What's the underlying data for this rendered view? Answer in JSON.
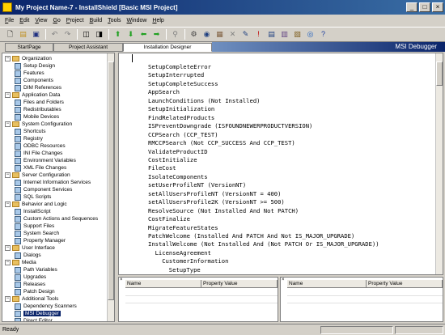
{
  "window": {
    "title": "My Project Name-7 - InstallShield [Basic MSI Project]"
  },
  "menu": [
    {
      "label": "File",
      "key": "F",
      "rest": "ile"
    },
    {
      "label": "Edit",
      "key": "E",
      "rest": "dit"
    },
    {
      "label": "View",
      "key": "V",
      "rest": "iew"
    },
    {
      "label": "Go",
      "key": "G",
      "rest": "o"
    },
    {
      "label": "Project",
      "key": "P",
      "rest": "roject"
    },
    {
      "label": "Build",
      "key": "B",
      "rest": "uild"
    },
    {
      "label": "Tools",
      "key": "T",
      "rest": "ools"
    },
    {
      "label": "Window",
      "key": "W",
      "rest": "indow"
    },
    {
      "label": "Help",
      "key": "H",
      "rest": "elp"
    }
  ],
  "tabs": {
    "start_page": "StartPage",
    "project_assistant": "Project Assistant",
    "installation_designer": "Installation Designer",
    "view_title": "MSI Debugger"
  },
  "tree": {
    "organization": "Organization",
    "setup_design": "Setup Design",
    "features": "Features",
    "components": "Components",
    "dim_references": "DIM References",
    "application_data": "Application Data",
    "files_and_folders": "Files and Folders",
    "redistributables": "Redistributables",
    "mobile_devices": "Mobile Devices",
    "system_configuration": "System Configuration",
    "shortcuts": "Shortcuts",
    "registry": "Registry",
    "odbc_resources": "ODBC Resources",
    "ini_file_changes": "INI File Changes",
    "environment_variables": "Environment Variables",
    "xml_file_changes": "XML File Changes",
    "server_configuration": "Server Configuration",
    "internet_information_services": "Internet Information Services",
    "component_services": "Component Services",
    "sql_scripts": "SQL Scripts",
    "behavior_and_logic": "Behavior and Logic",
    "installscript": "InstallScript",
    "custom_actions": "Custom Actions and Sequences",
    "support_files": "Support Files",
    "system_search": "System Search",
    "property_manager": "Property Manager",
    "user_interface": "User Interface",
    "dialogs": "Dialogs",
    "media": "Media",
    "path_variables": "Path Variables",
    "upgrades": "Upgrades",
    "releases": "Releases",
    "patch_design": "Patch Design",
    "additional_tools": "Additional Tools",
    "dependency_scanners": "Dependency Scanners",
    "msi_debugger": "MSI Debugger",
    "direct_editor": "Direct Editor"
  },
  "code_lines": [
    "SetupCompleteError",
    "SetupInterrupted",
    "SetupCompleteSuccess",
    "AppSearch",
    "LaunchConditions (Not Installed)",
    "SetupInitialization",
    "FindRelatedProducts",
    "ISPreventDowngrade (ISFOUNDNEWERPRODUCTVERSION)",
    "CCPSearch (CCP_TEST)",
    "RMCCPSearch (Not CCP_SUCCESS And CCP_TEST)",
    "ValidateProductID",
    "CostInitialize",
    "FileCost",
    "IsolateComponents",
    "setUserProfileNT (VersionNT)",
    "setAllUsersProfileNT (VersionNT = 400)",
    "setAllUsersProfile2K (VersionNT >= 500)",
    "ResolveSource (Not Installed And Not PATCH)",
    "CostFinalize",
    "MigrateFeatureStates",
    "PatchWelcome (Installed And PATCH And Not IS_MAJOR_UPGRADE)",
    "InstallWelcome (Not Installed And (Not PATCH Or IS_MAJOR_UPGRADE))",
    "LicenseAgreement",
    "CustomerInformation",
    "SetupType"
  ],
  "properties": {
    "left": {
      "name_header": "Name",
      "value_header": "Property Value"
    },
    "right": {
      "name_header": "Name",
      "value_header": "Property Value"
    }
  },
  "status": {
    "text": "Ready"
  }
}
